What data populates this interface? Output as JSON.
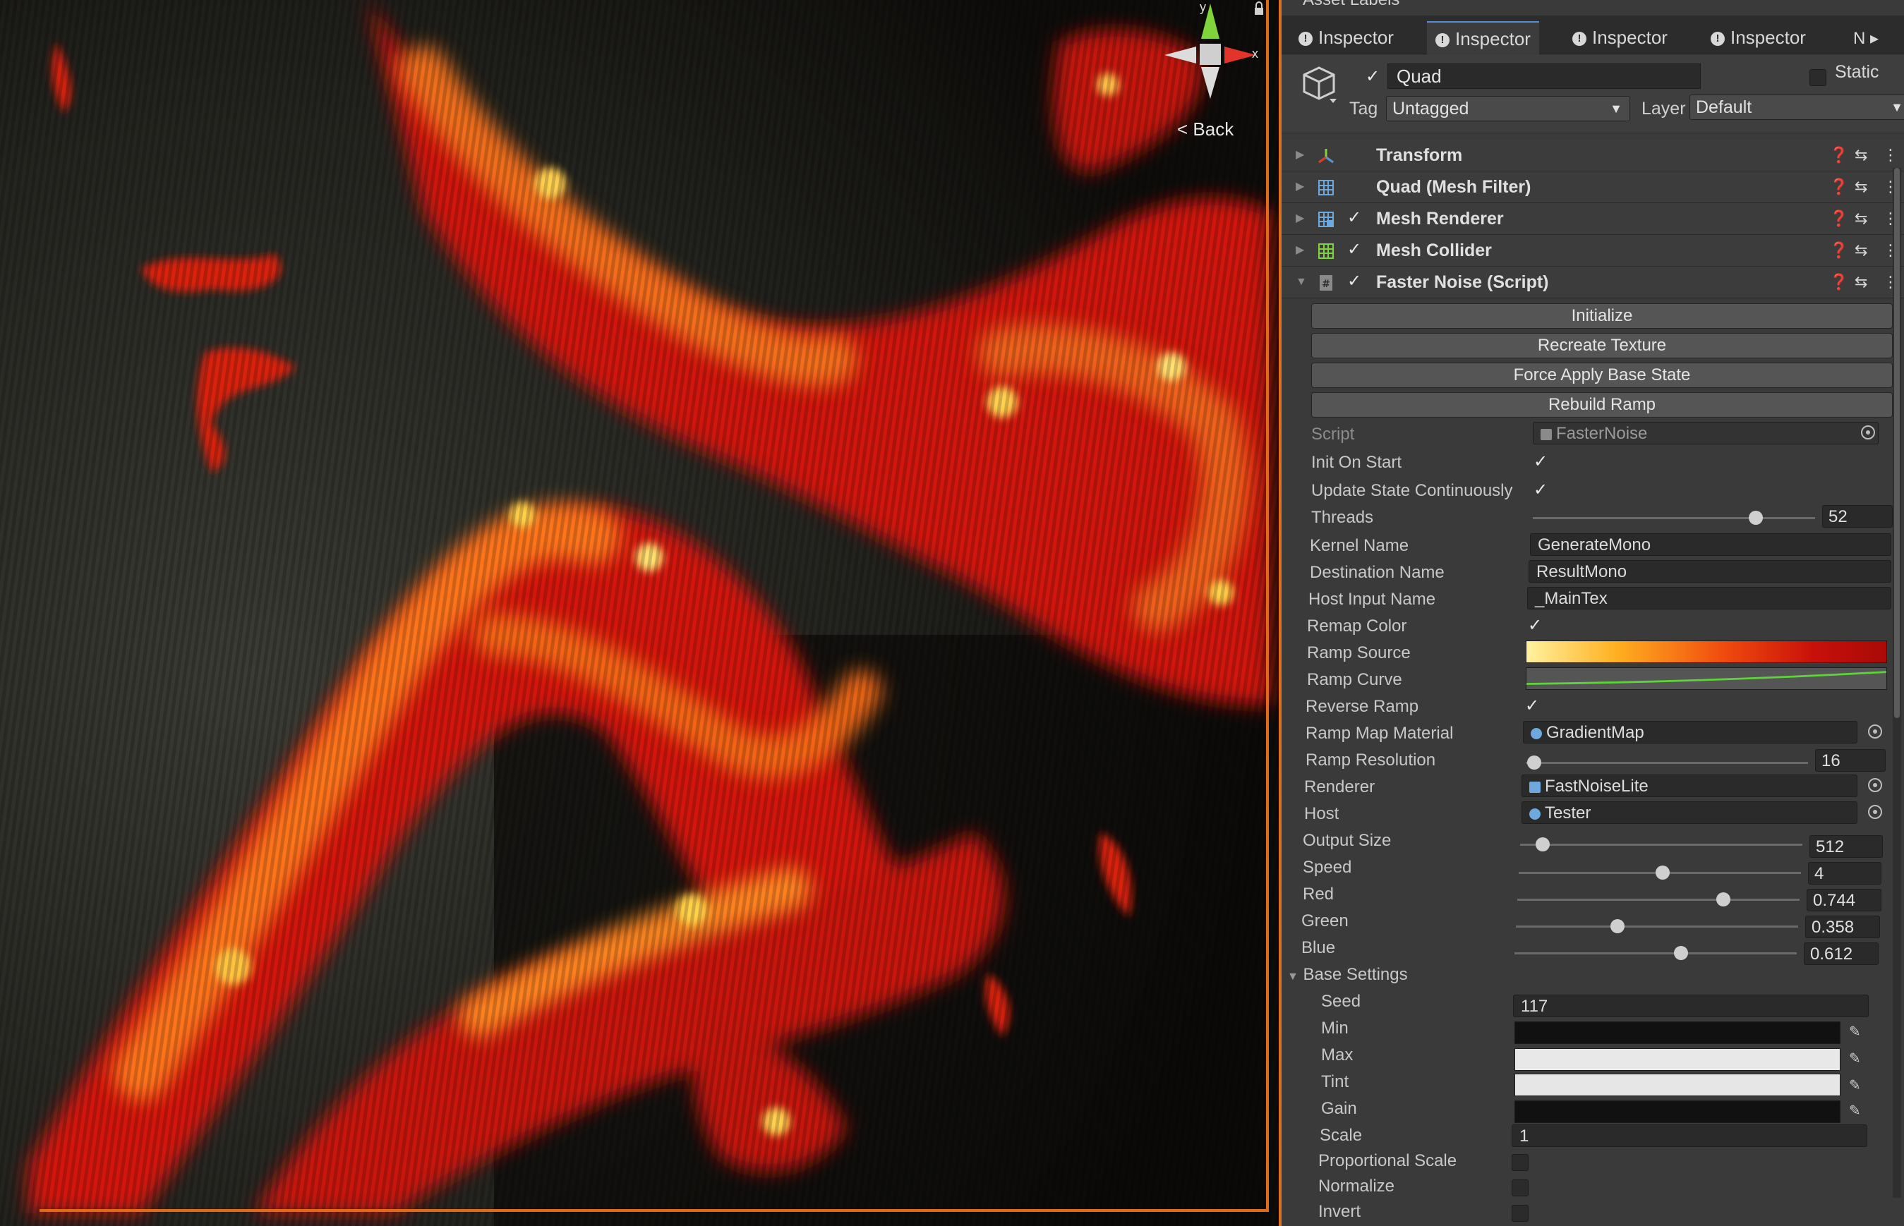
{
  "scene": {
    "gizmo_y": "y",
    "gizmo_x": "x",
    "view_label": "Back"
  },
  "inspector": {
    "top_label": "Asset Labels",
    "tabs": [
      {
        "label": "Inspector",
        "active": false
      },
      {
        "label": "Inspector",
        "active": true
      },
      {
        "label": "Inspector",
        "active": false
      },
      {
        "label": "Inspector",
        "active": false
      }
    ],
    "tab_more": "N ▸",
    "object": {
      "name": "Quad",
      "static_label": "Static",
      "tag_label": "Tag",
      "tag_value": "Untagged",
      "layer_label": "Layer",
      "layer_value": "Default"
    },
    "components": [
      {
        "title": "Transform",
        "icon": "transform-icon",
        "enabled": null
      },
      {
        "title": "Quad (Mesh Filter)",
        "icon": "mesh-filter-icon",
        "enabled": null
      },
      {
        "title": "Mesh Renderer",
        "icon": "mesh-renderer-icon",
        "enabled": true
      },
      {
        "title": "Mesh Collider",
        "icon": "mesh-collider-icon",
        "enabled": true
      },
      {
        "title": "Faster Noise (Script)",
        "icon": "script-icon",
        "enabled": true
      }
    ],
    "buttons": [
      "Initialize",
      "Recreate Texture",
      "Force Apply Base State",
      "Rebuild Ramp"
    ],
    "props": {
      "script_label": "Script",
      "script_value": "FasterNoise",
      "init_on_start": "Init On Start",
      "update_state": "Update State Continuously",
      "threads_label": "Threads",
      "threads_value": "52",
      "threads_fraction": 0.79,
      "kernel_label": "Kernel Name",
      "kernel_value": "GenerateMono",
      "dest_label": "Destination Name",
      "dest_value": "ResultMono",
      "host_input_label": "Host Input Name",
      "host_input_value": "_MainTex",
      "remap_label": "Remap Color",
      "ramp_source_label": "Ramp Source",
      "ramp_curve_label": "Ramp Curve",
      "reverse_ramp_label": "Reverse Ramp",
      "ramp_material_label": "Ramp Map Material",
      "ramp_material_value": "GradientMap",
      "ramp_res_label": "Ramp Resolution",
      "ramp_res_value": "16",
      "ramp_res_fraction": 0.03,
      "renderer_label": "Renderer",
      "renderer_value": "FastNoiseLite",
      "host_label": "Host",
      "host_value": "Tester",
      "output_size_label": "Output Size",
      "output_size_value": "512",
      "output_size_fraction": 0.08,
      "speed_label": "Speed",
      "speed_value": "4",
      "speed_fraction": 0.51,
      "red_label": "Red",
      "red_value": "0.744",
      "red_fraction": 0.73,
      "green_label": "Green",
      "green_value": "0.358",
      "green_fraction": 0.36,
      "blue_label": "Blue",
      "blue_value": "0.612",
      "blue_fraction": 0.59,
      "base_settings_label": "Base Settings",
      "seed_label": "Seed",
      "seed_value": "117",
      "min_label": "Min",
      "max_label": "Max",
      "tint_label": "Tint",
      "gain_label": "Gain",
      "scale_label": "Scale",
      "scale_value": "1",
      "prop_scale_label": "Proportional Scale",
      "normalize_label": "Normalize",
      "invert_label": "Invert"
    },
    "colors": {
      "min": "#111111",
      "max": "#e8e8e8",
      "tint": "#e6e6e6",
      "gain": "#111111"
    }
  }
}
